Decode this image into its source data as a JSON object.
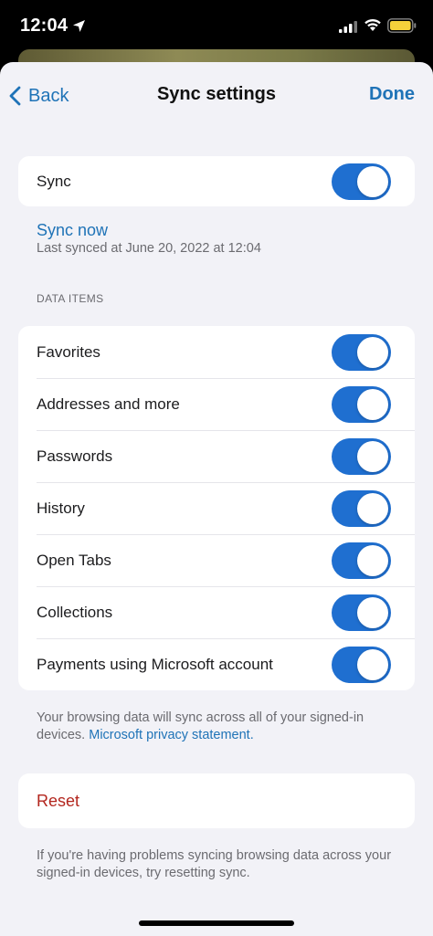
{
  "status_bar": {
    "time": "12:04"
  },
  "nav": {
    "back_label": "Back",
    "title": "Sync settings",
    "done_label": "Done"
  },
  "sync": {
    "label": "Sync",
    "enabled": true
  },
  "sync_now": {
    "label": "Sync now",
    "last_synced": "Last synced at June 20, 2022 at 12:04"
  },
  "data_items": {
    "header": "DATA ITEMS",
    "items": [
      {
        "label": "Favorites",
        "enabled": true
      },
      {
        "label": "Addresses and more",
        "enabled": true
      },
      {
        "label": "Passwords",
        "enabled": true
      },
      {
        "label": "History",
        "enabled": true
      },
      {
        "label": "Open Tabs",
        "enabled": true
      },
      {
        "label": "Collections",
        "enabled": true
      },
      {
        "label": "Payments using Microsoft account",
        "enabled": true
      }
    ]
  },
  "privacy_note": {
    "text": "Your browsing data will sync across all of your signed-in devices.",
    "link": "Microsoft privacy statement."
  },
  "reset": {
    "label": "Reset"
  },
  "reset_note": "If you're having problems syncing browsing data across your signed-in devices, try resetting sync.",
  "colors": {
    "accent": "#1f73b7",
    "toggle_on": "#1f6fd0",
    "destructive": "#b3261e",
    "background": "#f2f2f7"
  },
  "icons": [
    "location-arrow-icon",
    "signal-icon",
    "wifi-icon",
    "battery-icon",
    "chevron-left-icon"
  ]
}
